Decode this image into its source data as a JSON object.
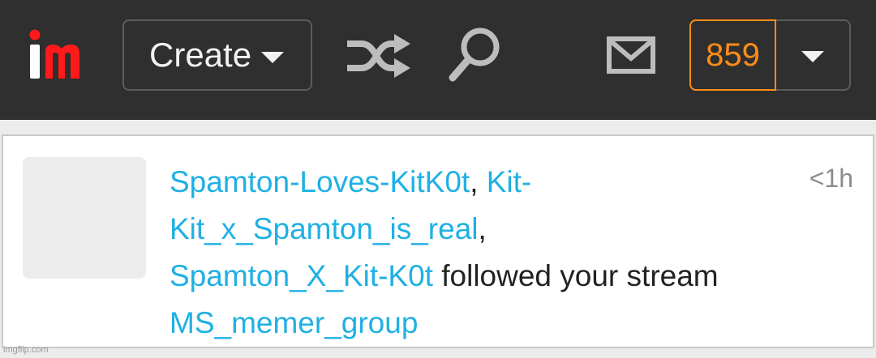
{
  "header": {
    "logo_text": "im",
    "create_label": "Create",
    "points": "859",
    "icons": {
      "shuffle": "shuffle-icon",
      "search": "search-icon",
      "mail": "mail-icon",
      "dropdown": "chevron-down-icon"
    }
  },
  "notification": {
    "users": [
      "Spamton-Loves-KitK0t",
      "Kit-Kit_x_Spamton_is_real",
      "Spamton_X_Kit-K0t"
    ],
    "sep1": ", ",
    "sep2": ",",
    "action": " followed your stream ",
    "stream": "MS_memer_group",
    "time": "<1h"
  },
  "watermark": "imgflip.com",
  "colors": {
    "topbar": "#2f2f2f",
    "accent_orange": "#ff8c1a",
    "link_blue": "#1fb0e4",
    "logo_red": "#ff1a1a"
  }
}
